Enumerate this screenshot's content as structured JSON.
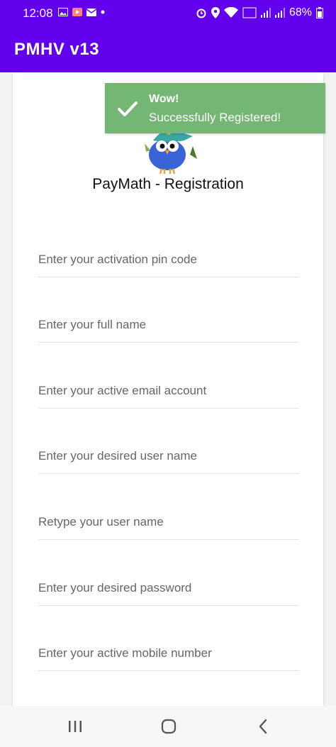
{
  "status_bar": {
    "time": "12:08",
    "battery": "68%"
  },
  "app_bar": {
    "title": "PMHV v13"
  },
  "page": {
    "title": "PayMath - Registration"
  },
  "fields": [
    {
      "placeholder": "Enter your activation pin code"
    },
    {
      "placeholder": "Enter your full name"
    },
    {
      "placeholder": "Enter your active email account"
    },
    {
      "placeholder": "Enter your desired user name"
    },
    {
      "placeholder": "Retype your user name"
    },
    {
      "placeholder": "Enter your desired password"
    },
    {
      "placeholder": "Enter your active mobile number"
    }
  ],
  "toast": {
    "title": "Wow!",
    "message": "Successfully Registered!",
    "color": "#74b673",
    "icon": "check-icon"
  },
  "colors": {
    "primary": "#6200ee"
  },
  "nav": {
    "recents_icon": "recents-icon",
    "home_icon": "home-icon",
    "back_icon": "back-icon"
  }
}
